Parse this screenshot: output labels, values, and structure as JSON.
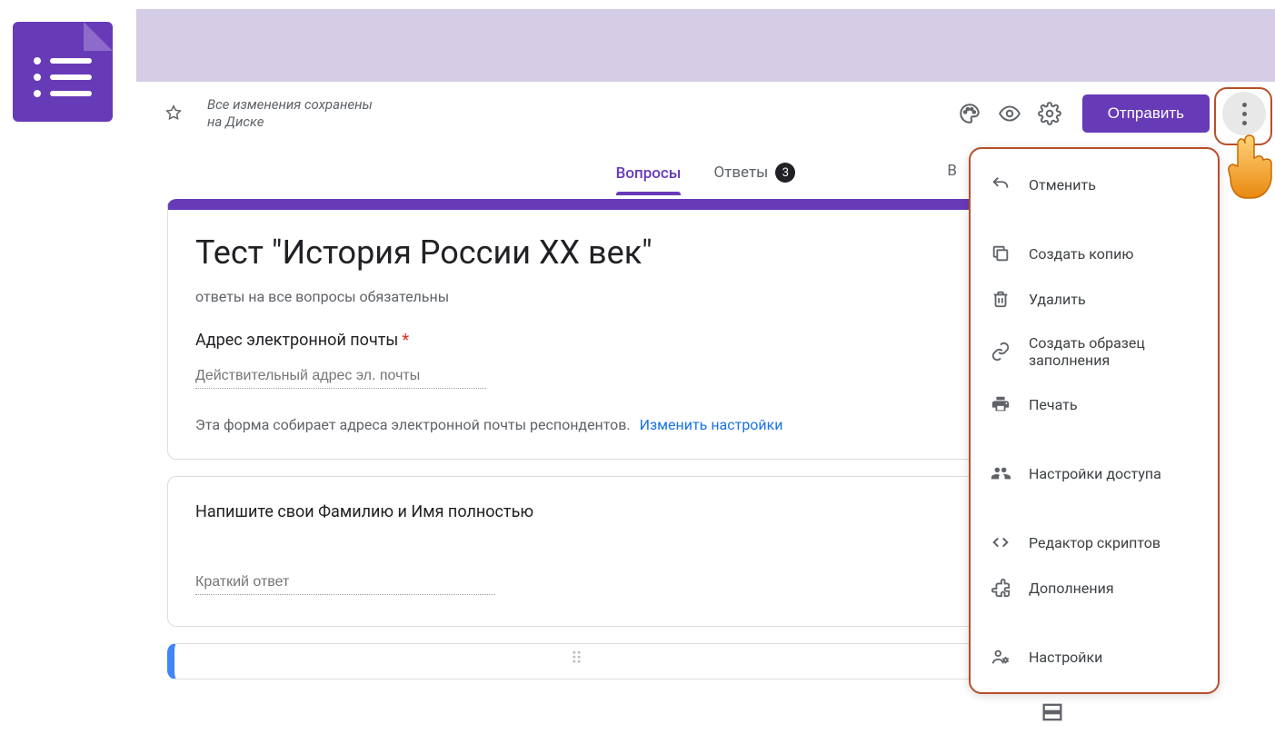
{
  "toolbar": {
    "save_status_line1": "Все изменения сохранены",
    "save_status_line2": "на Диске",
    "send_label": "Отправить"
  },
  "tabs": {
    "questions": "Вопросы",
    "answers": "Ответы",
    "answers_count": "3",
    "cut_letter": "В"
  },
  "form": {
    "title": "Тест \"История России XX век\"",
    "description": "ответы на все вопросы обязательны",
    "email_label": "Адрес электронной почты",
    "email_placeholder": "Действительный адрес эл. почты",
    "email_note": "Эта форма собирает адреса электронной почты респондентов.",
    "email_note_link": "Изменить настройки",
    "q1_title": "Напишите свои Фамилию и Имя полностью",
    "q1_placeholder": "Краткий ответ"
  },
  "menu": {
    "undo": "Отменить",
    "copy": "Создать копию",
    "delete": "Удалить",
    "prefill": "Создать образец заполнения",
    "print": "Печать",
    "collaborators": "Настройки доступа",
    "script": "Редактор скриптов",
    "addons": "Дополнения",
    "preferences": "Настройки"
  }
}
